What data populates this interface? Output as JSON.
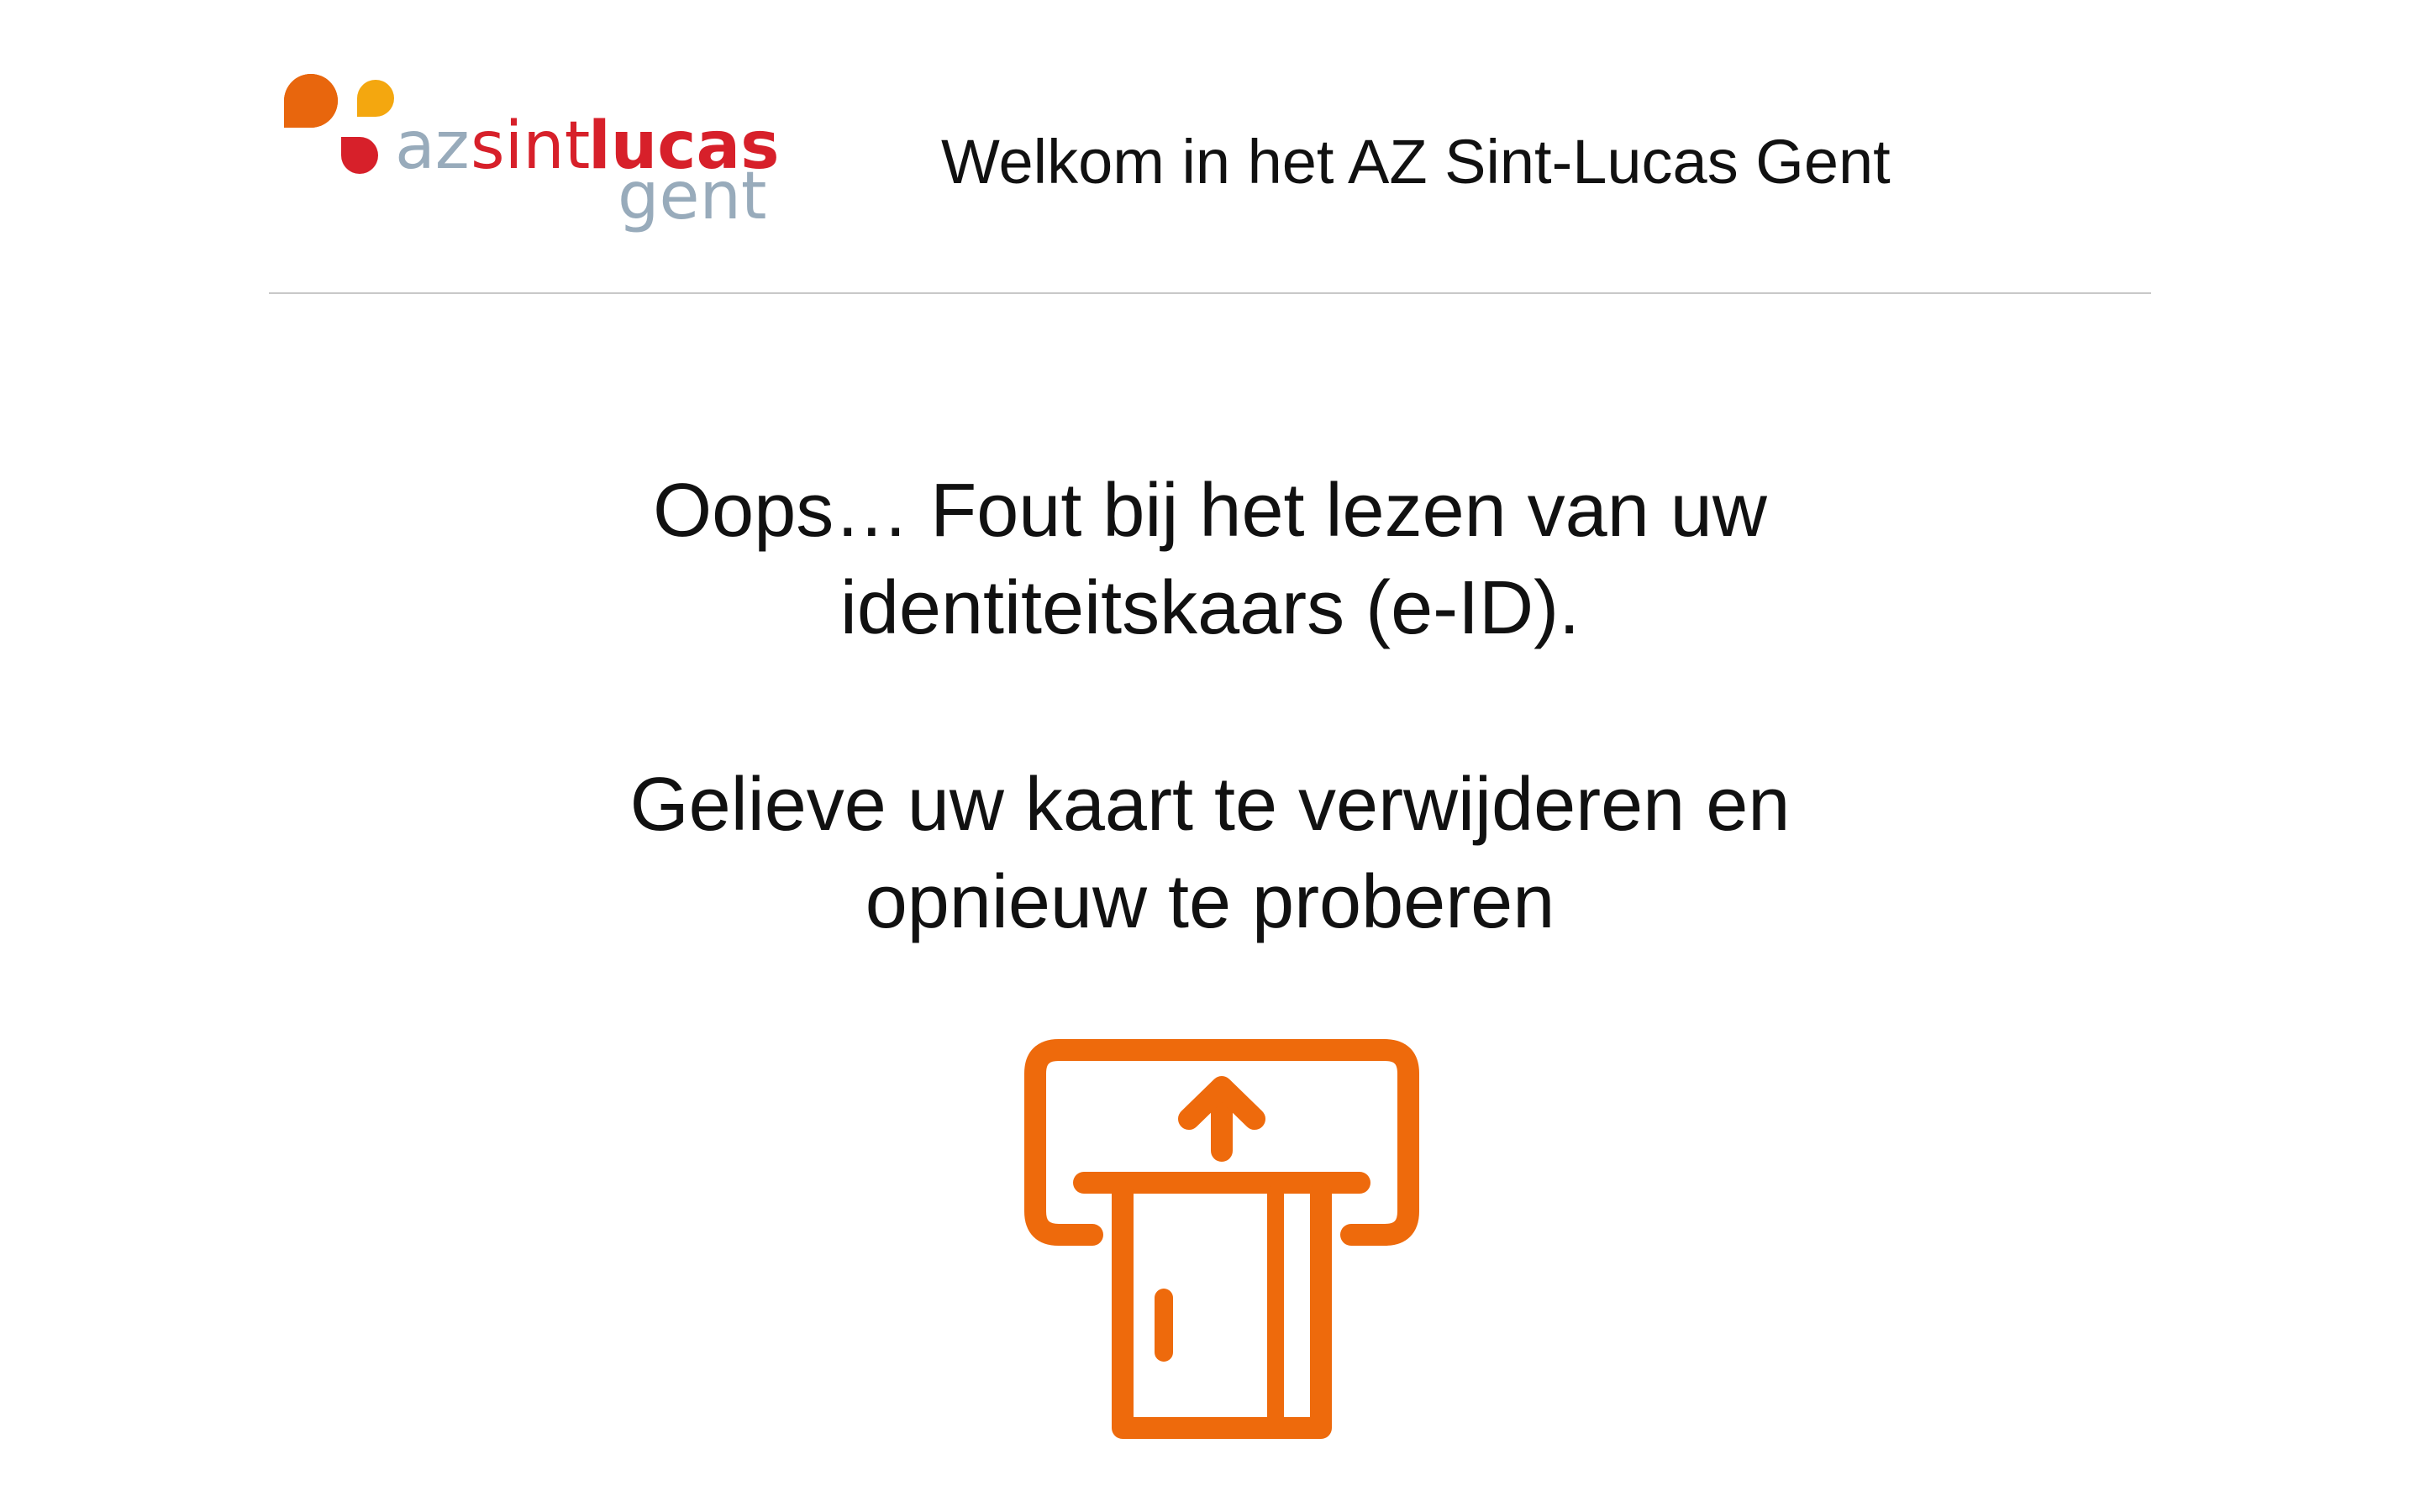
{
  "header": {
    "logo": {
      "brand_az": "az",
      "brand_sint": "sint",
      "brand_lucas": "lucas",
      "brand_city": "gent",
      "colors": {
        "dot_orange": "#e8660d",
        "dot_yellow": "#f4a70f",
        "dot_red": "#d7202a",
        "text_gray": "#98abbb",
        "text_red": "#d7202a"
      }
    },
    "welcome_text": "Welkom in het AZ Sint-Lucas Gent"
  },
  "main": {
    "error_lines": [
      "Oops… Fout bij het lezen van uw",
      "identiteitskaars (e-ID)."
    ],
    "instruction_lines": [
      "Gelieve uw kaart te verwijderen en",
      "opnieuw te proberen"
    ],
    "icon": {
      "name": "remove-card-icon",
      "color": "#ee6a0c"
    }
  }
}
